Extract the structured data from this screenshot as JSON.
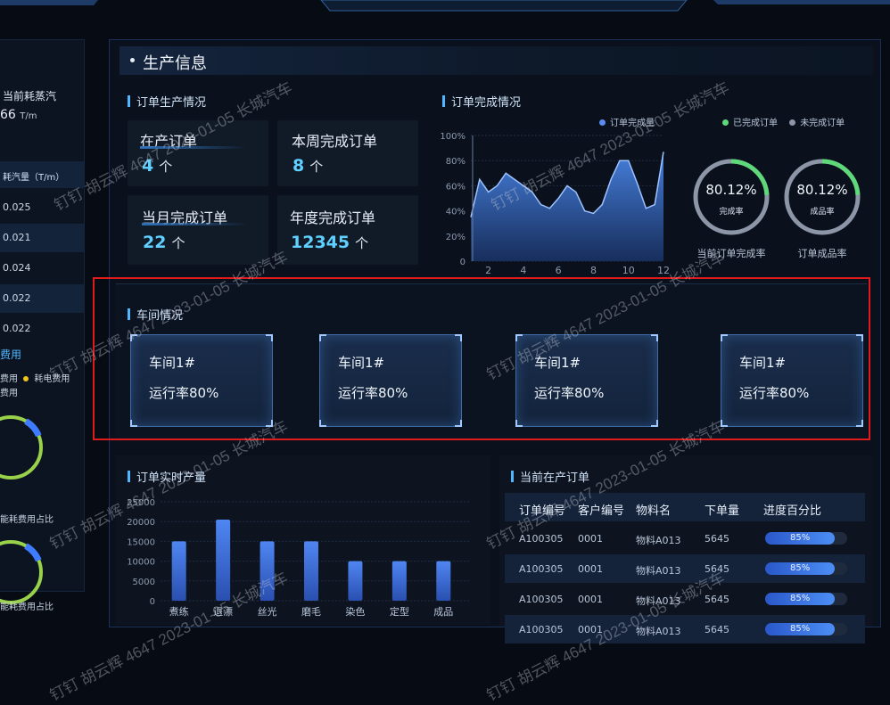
{
  "main": {
    "title": "生产信息"
  },
  "left": {
    "steam_label": "当前耗蒸汽",
    "steam_value": "66",
    "steam_unit": "T/m",
    "list_header": "耗汽量（T/m）",
    "list_values": [
      "0.025",
      "0.021",
      "0.024",
      "0.022",
      "0.022"
    ],
    "cost_title": "费用",
    "legend_a": "费用",
    "legend_b": "耗电费用",
    "legend_c": "费用",
    "ring1_caption": "能耗费用占比",
    "ring2_caption": "能耗费用占比",
    "accent": "#4fb6ff",
    "ring_color": "#9ad14b",
    "ring_accent": "#3f7bff"
  },
  "order_production": {
    "title": "订单生产情况",
    "cards": [
      {
        "label": "在产订单",
        "value": "4",
        "unit": "个"
      },
      {
        "label": "本周完成订单",
        "value": "8",
        "unit": "个"
      },
      {
        "label": "当月完成订单",
        "value": "22",
        "unit": "个"
      },
      {
        "label": "年度完成订单",
        "value": "12345",
        "unit": "个"
      }
    ]
  },
  "order_completion": {
    "title": "订单完成情况",
    "legend_series": "订单完成量",
    "legend_done": "已完成订单",
    "legend_undone": "未完成订单",
    "gauges": [
      {
        "value": "80.12%",
        "inner": "完成率",
        "caption": "当前订单完成率",
        "fraction": 0.8012
      },
      {
        "value": "80.12%",
        "inner": "成品率",
        "caption": "订单成品率",
        "fraction": 0.8012
      }
    ],
    "done_color": "#5fd87a",
    "undone_color": "#8c96a6"
  },
  "workshop": {
    "title": "车间情况",
    "items": [
      {
        "name": "车间1#",
        "rate": "运行率80%"
      },
      {
        "name": "车间1#",
        "rate": "运行率80%"
      },
      {
        "name": "车间1#",
        "rate": "运行率80%"
      },
      {
        "name": "车间1#",
        "rate": "运行率80%"
      }
    ]
  },
  "realtime": {
    "title": "订单实时产量"
  },
  "current_orders": {
    "title": "当前在产订单",
    "headers": [
      "订单编号",
      "客户编号",
      "物料名",
      "下单量",
      "进度百分比"
    ],
    "rows": [
      {
        "id": "A100305",
        "customer": "0001",
        "material": "物料A013",
        "qty": "5645",
        "progress": "85%",
        "fraction": 0.85
      },
      {
        "id": "A100305",
        "customer": "0001",
        "material": "物料A013",
        "qty": "5645",
        "progress": "85%",
        "fraction": 0.85
      },
      {
        "id": "A100305",
        "customer": "0001",
        "material": "物料A013",
        "qty": "5645",
        "progress": "85%",
        "fraction": 0.85
      },
      {
        "id": "A100305",
        "customer": "0001",
        "material": "物料A013",
        "qty": "5645",
        "progress": "85%",
        "fraction": 0.85
      }
    ]
  },
  "watermark": "钉钉 胡云辉 4647 2023-01-05 长城汽车",
  "chart_data": [
    {
      "type": "area",
      "series": [
        {
          "name": "订单完成量",
          "x": [
            1,
            1.5,
            2,
            2.5,
            3,
            3.5,
            4,
            4.5,
            5,
            5.5,
            6,
            6.5,
            7,
            7.5,
            8,
            8.5,
            9,
            9.5,
            10,
            10.5,
            11,
            11.5,
            12
          ],
          "values": [
            35,
            65,
            55,
            60,
            70,
            65,
            60,
            55,
            45,
            42,
            50,
            60,
            55,
            40,
            38,
            45,
            65,
            80,
            80,
            62,
            42,
            45,
            87
          ]
        }
      ],
      "yticks": [
        "0",
        "20%",
        "40%",
        "60%",
        "80%",
        "100%"
      ],
      "xticks": [
        "2",
        "4",
        "6",
        "8",
        "10",
        "12"
      ],
      "ylim": [
        0,
        100
      ],
      "xlim": [
        1,
        12
      ]
    },
    {
      "type": "bar",
      "categories": [
        "煮练",
        "退漂",
        "丝光",
        "磨毛",
        "染色",
        "定型",
        "成品"
      ],
      "values": [
        15000,
        20500,
        15000,
        15000,
        10000,
        10000,
        10000
      ],
      "yticks": [
        "0",
        "5000",
        "10000",
        "15000",
        "20000",
        "25000"
      ],
      "ylim": [
        0,
        25000
      ]
    }
  ]
}
